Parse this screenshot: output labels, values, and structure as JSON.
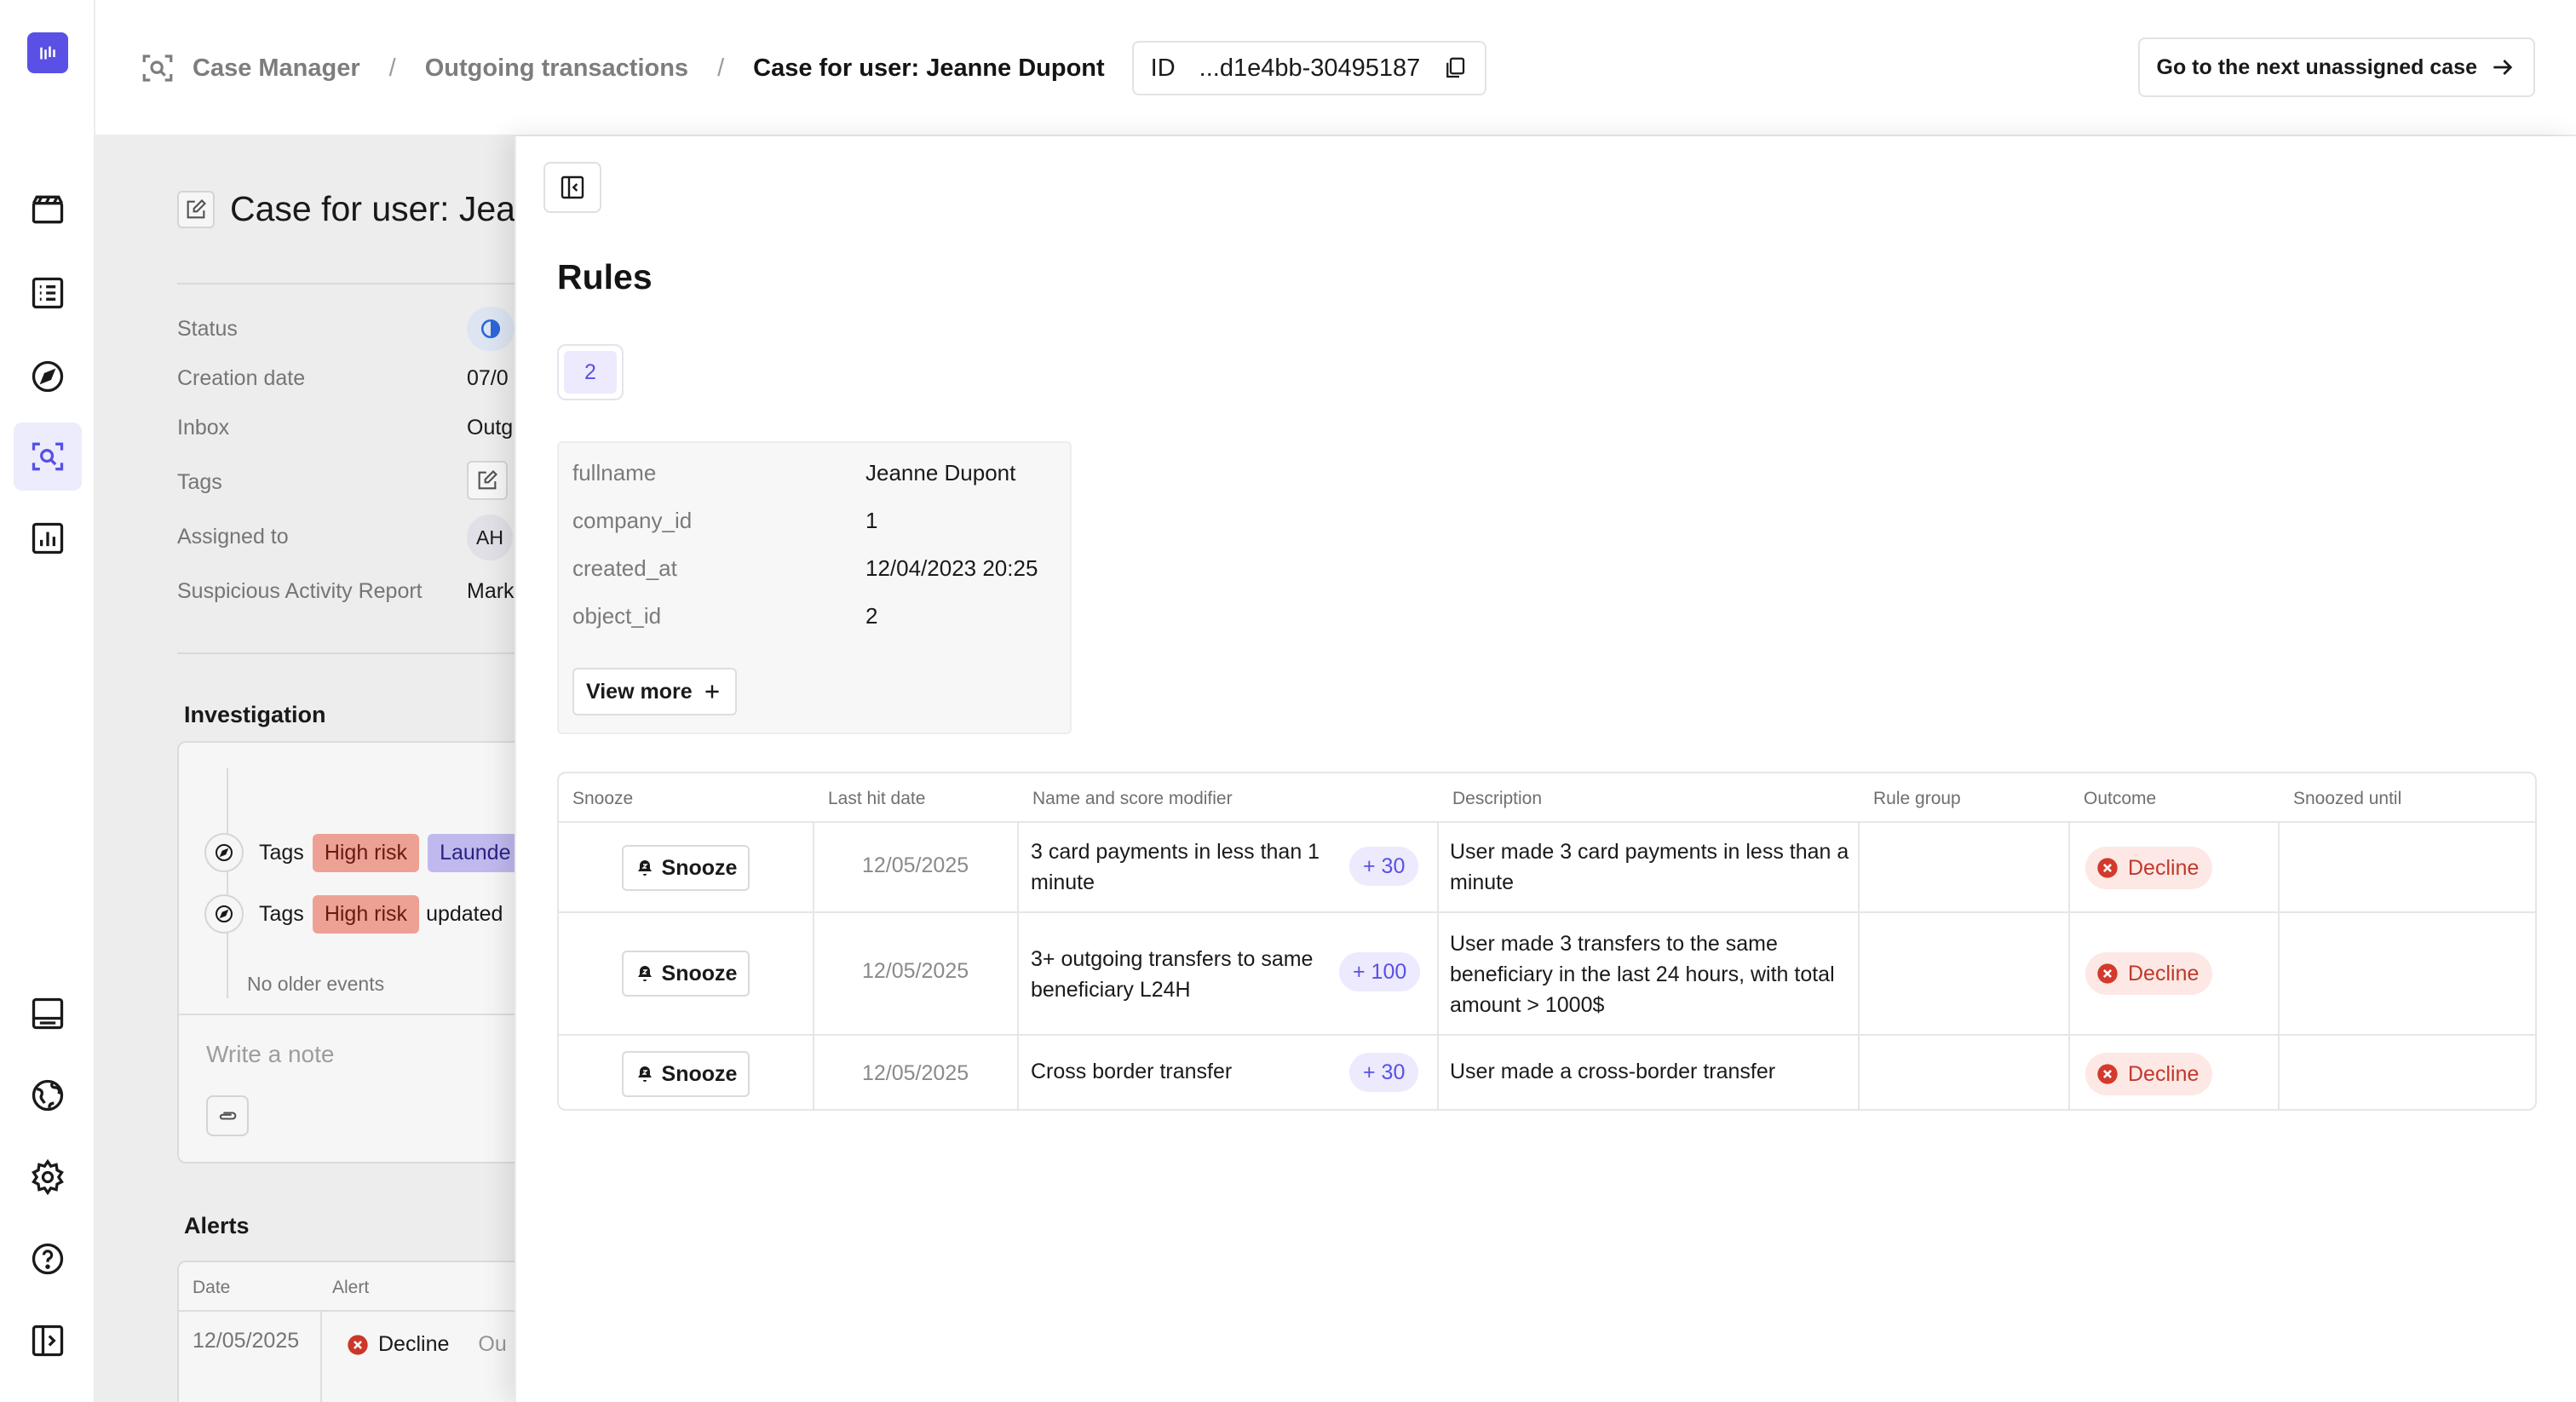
{
  "sidebar": {
    "logo": "app-logo",
    "nav_top": [
      "clapperboard-icon",
      "list-icon",
      "compass-icon",
      "case-search-icon",
      "analytics-icon"
    ],
    "nav_bottom": [
      "panel-bottom-icon",
      "globe-icon",
      "settings-icon",
      "help-icon",
      "expand-sidebar-icon"
    ],
    "active": "case-search-icon"
  },
  "header": {
    "breadcrumbs": [
      "Case Manager",
      "Outgoing transactions",
      "Case for user: Jeanne Dupont"
    ],
    "id_label": "ID",
    "id_value": "...d1e4bb-30495187",
    "next_button": "Go to the next unassigned case"
  },
  "case": {
    "title": "Case for user: Jeanne Dupont",
    "properties": [
      {
        "label": "Status",
        "value": ""
      },
      {
        "label": "Creation date",
        "value": "07/0"
      },
      {
        "label": "Inbox",
        "value": "Outg"
      },
      {
        "label": "Tags",
        "value": ""
      },
      {
        "label": "Assigned to",
        "value": "AH"
      },
      {
        "label": "Suspicious Activity Report",
        "value": "Mark"
      }
    ],
    "investigation": {
      "heading": "Investigation",
      "events": [
        {
          "label": "Tags",
          "tags": [
            "High risk",
            "Launde"
          ],
          "suffix": ""
        },
        {
          "label": "Tags",
          "tags": [
            "High risk"
          ],
          "suffix": "updated"
        }
      ],
      "no_older": "No older events",
      "note_placeholder": "Write a note"
    },
    "alerts": {
      "heading": "Alerts",
      "columns": [
        "Date",
        "Alert"
      ],
      "rows": [
        {
          "date": "12/05/2025",
          "outcome": "Decline",
          "extra": "Ou"
        }
      ]
    }
  },
  "rules_panel": {
    "title": "Rules",
    "count": "2",
    "object": [
      {
        "key": "fullname",
        "value": "Jeanne Dupont"
      },
      {
        "key": "company_id",
        "value": "1"
      },
      {
        "key": "created_at",
        "value": "12/04/2023 20:25"
      },
      {
        "key": "object_id",
        "value": "2"
      }
    ],
    "view_more": "View more",
    "table": {
      "columns": [
        "Snooze",
        "Last hit date",
        "Name and score modifier",
        "Description",
        "Rule group",
        "Outcome",
        "Snoozed until"
      ],
      "rows": [
        {
          "snooze": "Snooze",
          "date": "12/05/2025",
          "name": "3 card payments in less than 1 minute",
          "score": "+ 30",
          "description": "User made 3 card payments in less than a minute",
          "rule_group": "",
          "outcome": "Decline",
          "snoozed_until": ""
        },
        {
          "snooze": "Snooze",
          "date": "12/05/2025",
          "name": "3+ outgoing transfers to same beneficiary L24H",
          "score": "+ 100",
          "description": "User made 3 transfers to the same beneficiary in the last 24 hours, with total amount > 1000$",
          "rule_group": "",
          "outcome": "Decline",
          "snoozed_until": ""
        },
        {
          "snooze": "Snooze",
          "date": "12/05/2025",
          "name": "Cross border transfer",
          "score": "+ 30",
          "description": "User made a cross-border transfer",
          "rule_group": "",
          "outcome": "Decline",
          "snoozed_until": ""
        }
      ]
    }
  },
  "colors": {
    "accent": "#5a50e6",
    "decline": "#d33a2c",
    "risk_tag": "#f6a79a",
    "laundering_tag": "#c6c0f7"
  }
}
